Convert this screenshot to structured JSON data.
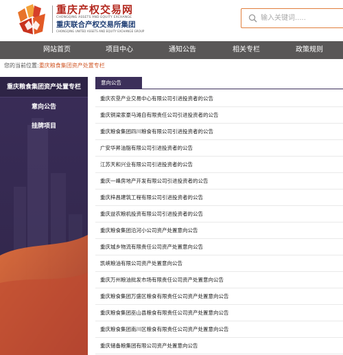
{
  "header": {
    "logo_cn_top": "重庆产权交易网",
    "logo_en_top": "CHONGQING ASSETS AND EQUITY EXCHANGE",
    "logo_cn_bottom": "重庆联合产权交易所集团",
    "logo_en_bottom": "CHONGQING UNITED ASSETS AND EQUITY EXCHANGE GROUP",
    "search_placeholder": "输入关键词.....",
    "colors": {
      "logo_red": "#b3281e",
      "logo_blue": "#1f3e74",
      "search_border": "#e07e3c"
    }
  },
  "nav": {
    "items": [
      {
        "label": "网站首页"
      },
      {
        "label": "项目中心"
      },
      {
        "label": "通知公告"
      },
      {
        "label": "相关专栏"
      },
      {
        "label": "政策规则"
      }
    ],
    "color": "#595757"
  },
  "breadcrumb": {
    "prefix": "您的当前位置:",
    "current": "重庆粮食集团资产处置专栏"
  },
  "sidebar": {
    "title": "重庆粮食集团资产处置专栏",
    "items": [
      {
        "label": "意向公告"
      },
      {
        "label": "挂牌项目"
      }
    ],
    "color": "#3c2f5a"
  },
  "main": {
    "tab_label": "意向公告",
    "announcements": [
      "重庆农垦产业交易中心有限公司引进投资者的公告",
      "重庆铜梁家豪马滩自有限责任公司引进投资者的公告",
      "重庆粮食集团四川粮食有限公司引进投资者的公告",
      "广安华昇油脂有限公司引进投资者的公告",
      "江苏天和兴业有限公司引进投资者的公告",
      "重庆一峰房地产开发有限公司引进投资者的公告",
      "重庆梓昌建筑工程有限公司引进投资者的公告",
      "重庆益农粮机投资有限公司引进投资者的公告",
      "重庆粮食集团沿河小公司资产处置意向公告",
      "重庆城乡物流有限责任公司资产处置意向公告",
      "凯峡粮油有限公司资产处置意向公告",
      "重庆万州粮油批发市场有限责任公司资产处置意向公告",
      "重庆粮食集团万盛区粮食有限责任公司资产处置意向公告",
      "重庆粮食集团巫山县粮食有限责任公司资产处置意向公告",
      "重庆粮食集团南川区粮食有限责任公司资产处置意向公告",
      "重庆储备粮集团有限公司资产处置意向公告"
    ]
  }
}
